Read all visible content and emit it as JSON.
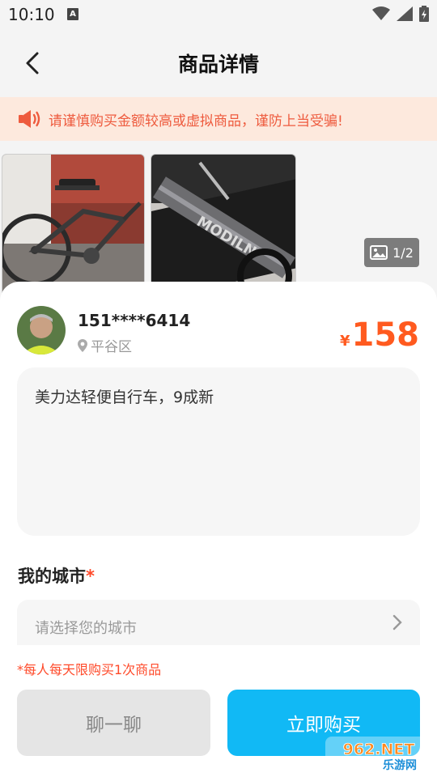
{
  "status_bar": {
    "time": "10:10",
    "notification_letter": "A"
  },
  "header": {
    "title": "商品详情"
  },
  "warning": {
    "text": "请谨慎购买金额较高或虚拟商品，谨防上当受骗!"
  },
  "gallery": {
    "counter": "1/2"
  },
  "seller": {
    "name": "151****6414",
    "location": "平谷区"
  },
  "price": {
    "symbol": "¥",
    "value": "158"
  },
  "description": "美力达轻便自行车，9成新",
  "city": {
    "label": "我的城市",
    "required_mark": "*",
    "placeholder": "请选择您的城市"
  },
  "limit_note": "*每人每天限购买1次商品",
  "buttons": {
    "chat": "聊一聊",
    "buy": "立即购买"
  },
  "watermark": {
    "top": "962.NET",
    "bottom": "乐游网"
  },
  "colors": {
    "accent_orange": "#ff5a1f",
    "buy_blue": "#11b9f5",
    "warning_bg": "#fde9dd",
    "warning_text": "#ee5b3e"
  }
}
